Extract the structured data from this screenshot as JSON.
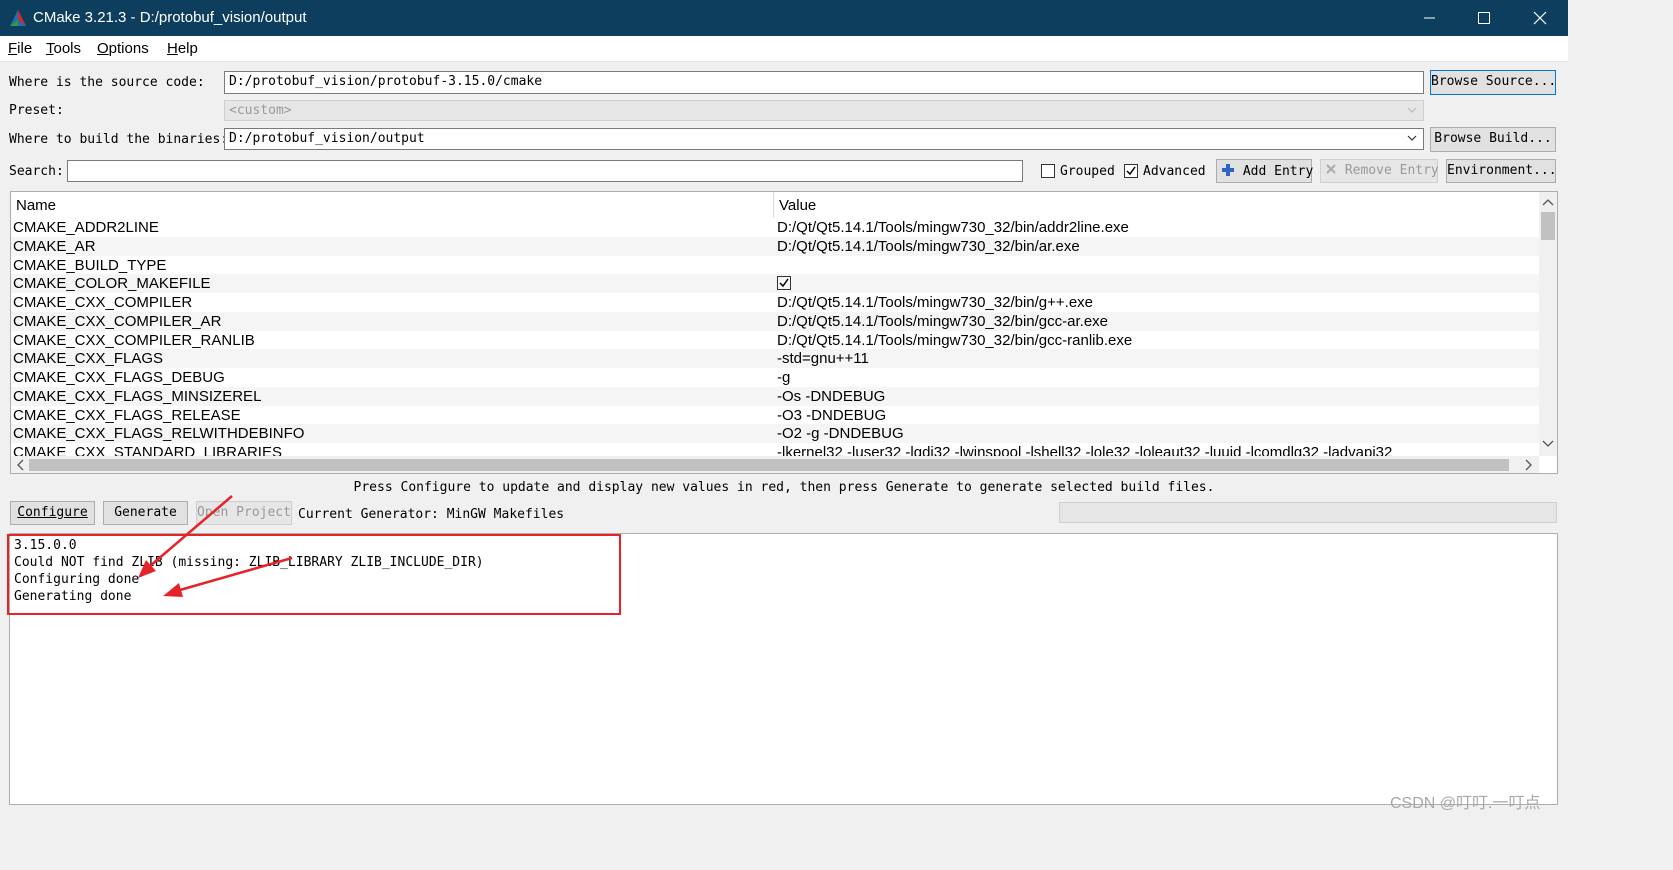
{
  "window": {
    "title": "CMake 3.21.3 - D:/protobuf_vision/output",
    "icon": "cmake-triangle-icon"
  },
  "menu": [
    "File",
    "Tools",
    "Options",
    "Help"
  ],
  "source": {
    "label": "Where is the source code:",
    "value": "D:/protobuf_vision/protobuf-3.15.0/cmake",
    "browse": "Browse Source..."
  },
  "preset": {
    "label": "Preset:",
    "value": "<custom>"
  },
  "build": {
    "label": "Where to build the binaries:",
    "value": "D:/protobuf_vision/output",
    "browse": "Browse Build..."
  },
  "search": {
    "label": "Search:",
    "value": ""
  },
  "options": {
    "grouped": {
      "label": "Grouped",
      "checked": false
    },
    "advanced": {
      "label": "Advanced",
      "checked": true
    },
    "add_entry": "Add Entry",
    "remove_entry": "Remove Entry",
    "environment": "Environment..."
  },
  "table": {
    "headers": [
      "Name",
      "Value"
    ],
    "rows": [
      {
        "name": "CMAKE_ADDR2LINE",
        "value": "D:/Qt/Qt5.14.1/Tools/mingw730_32/bin/addr2line.exe"
      },
      {
        "name": "CMAKE_AR",
        "value": "D:/Qt/Qt5.14.1/Tools/mingw730_32/bin/ar.exe"
      },
      {
        "name": "CMAKE_BUILD_TYPE",
        "value": ""
      },
      {
        "name": "CMAKE_COLOR_MAKEFILE",
        "value": "",
        "checked": true
      },
      {
        "name": "CMAKE_CXX_COMPILER",
        "value": "D:/Qt/Qt5.14.1/Tools/mingw730_32/bin/g++.exe"
      },
      {
        "name": "CMAKE_CXX_COMPILER_AR",
        "value": "D:/Qt/Qt5.14.1/Tools/mingw730_32/bin/gcc-ar.exe"
      },
      {
        "name": "CMAKE_CXX_COMPILER_RANLIB",
        "value": "D:/Qt/Qt5.14.1/Tools/mingw730_32/bin/gcc-ranlib.exe"
      },
      {
        "name": "CMAKE_CXX_FLAGS",
        "value": "-std=gnu++11"
      },
      {
        "name": "CMAKE_CXX_FLAGS_DEBUG",
        "value": "-g"
      },
      {
        "name": "CMAKE_CXX_FLAGS_MINSIZEREL",
        "value": "-Os -DNDEBUG"
      },
      {
        "name": "CMAKE_CXX_FLAGS_RELEASE",
        "value": "-O3 -DNDEBUG"
      },
      {
        "name": "CMAKE_CXX_FLAGS_RELWITHDEBINFO",
        "value": "-O2 -g -DNDEBUG"
      },
      {
        "name": "CMAKE_CXX_STANDARD_LIBRARIES",
        "value": "-lkernel32 -luser32 -lgdi32 -lwinspool -lshell32 -lole32 -loleaut32 -luuid -lcomdlg32 -ladvapi32"
      }
    ]
  },
  "hint": "Press Configure to update and display new values in red, then press Generate to generate selected build files.",
  "actions": {
    "configure": "Configure",
    "generate": "Generate",
    "open_project": "Open Project",
    "generator_label": "Current Generator: MinGW Makefiles"
  },
  "output": {
    "lines": [
      "3.15.0.0",
      "Could NOT find ZLIB (missing: ZLIB_LIBRARY ZLIB_INCLUDE_DIR)",
      "Configuring done",
      "Generating done"
    ]
  },
  "annotation_color": "#e5242a",
  "watermark": "CSDN @叮叮.一叮点"
}
